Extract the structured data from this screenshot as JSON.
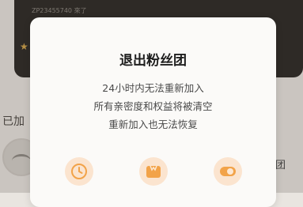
{
  "background": {
    "notice": "ZP23455740 來了",
    "partial_left_text": "已加",
    "partial_right_text": "团"
  },
  "modal": {
    "title": "退出粉丝团",
    "lines": [
      "24小时内无法重新加入",
      "所有亲密度和权益将被清空",
      "重新加入也无法恢复"
    ],
    "icons": [
      "clock-icon",
      "card-icon",
      "toggle-icon"
    ]
  },
  "colors": {
    "accent": "#f2a349",
    "icon_bg": "#fbe4cf",
    "modal_bg": "#fbfaf8"
  }
}
